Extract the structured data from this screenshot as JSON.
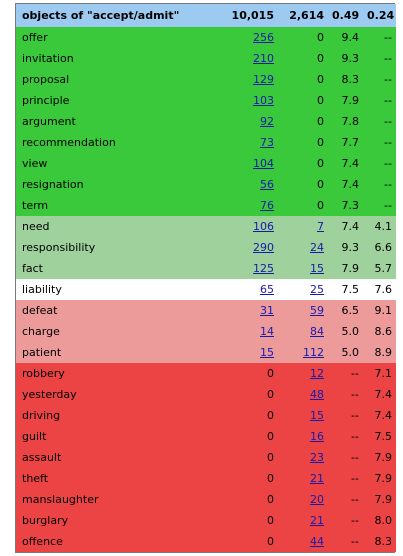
{
  "colors": {
    "header": "#9ccaf0",
    "bright_green": "#39c93a",
    "light_green": "#9ed19b",
    "white": "#ffffff",
    "pink": "#ec9a9a",
    "red": "#ec4444"
  },
  "header": {
    "label": "objects of \"accept/admit\"",
    "col1": "10,015",
    "col2": "2,614",
    "col3": "0.49",
    "col4": "0.24"
  },
  "rows": [
    {
      "word": "offer",
      "c1": "256",
      "c1_link": true,
      "c2": "0",
      "c2_link": false,
      "c3": "9.4",
      "c4": "--",
      "group": "bright_green"
    },
    {
      "word": "invitation",
      "c1": "210",
      "c1_link": true,
      "c2": "0",
      "c2_link": false,
      "c3": "9.3",
      "c4": "--",
      "group": "bright_green"
    },
    {
      "word": "proposal",
      "c1": "129",
      "c1_link": true,
      "c2": "0",
      "c2_link": false,
      "c3": "8.3",
      "c4": "--",
      "group": "bright_green"
    },
    {
      "word": "principle",
      "c1": "103",
      "c1_link": true,
      "c2": "0",
      "c2_link": false,
      "c3": "7.9",
      "c4": "--",
      "group": "bright_green"
    },
    {
      "word": "argument",
      "c1": "92",
      "c1_link": true,
      "c2": "0",
      "c2_link": false,
      "c3": "7.8",
      "c4": "--",
      "group": "bright_green"
    },
    {
      "word": "recommendation",
      "c1": "73",
      "c1_link": true,
      "c2": "0",
      "c2_link": false,
      "c3": "7.7",
      "c4": "--",
      "group": "bright_green"
    },
    {
      "word": "view",
      "c1": "104",
      "c1_link": true,
      "c2": "0",
      "c2_link": false,
      "c3": "7.4",
      "c4": "--",
      "group": "bright_green"
    },
    {
      "word": "resignation",
      "c1": "56",
      "c1_link": true,
      "c2": "0",
      "c2_link": false,
      "c3": "7.4",
      "c4": "--",
      "group": "bright_green"
    },
    {
      "word": "term",
      "c1": "76",
      "c1_link": true,
      "c2": "0",
      "c2_link": false,
      "c3": "7.3",
      "c4": "--",
      "group": "bright_green"
    },
    {
      "word": "need",
      "c1": "106",
      "c1_link": true,
      "c2": "7",
      "c2_link": true,
      "c3": "7.4",
      "c4": "4.1",
      "group": "light_green"
    },
    {
      "word": "responsibility",
      "c1": "290",
      "c1_link": true,
      "c2": "24",
      "c2_link": true,
      "c3": "9.3",
      "c4": "6.6",
      "group": "light_green"
    },
    {
      "word": "fact",
      "c1": "125",
      "c1_link": true,
      "c2": "15",
      "c2_link": true,
      "c3": "7.9",
      "c4": "5.7",
      "group": "light_green"
    },
    {
      "word": "liability",
      "c1": "65",
      "c1_link": true,
      "c2": "25",
      "c2_link": true,
      "c3": "7.5",
      "c4": "7.6",
      "group": "white"
    },
    {
      "word": "defeat",
      "c1": "31",
      "c1_link": true,
      "c2": "59",
      "c2_link": true,
      "c3": "6.5",
      "c4": "9.1",
      "group": "pink"
    },
    {
      "word": "charge",
      "c1": "14",
      "c1_link": true,
      "c2": "84",
      "c2_link": true,
      "c3": "5.0",
      "c4": "8.6",
      "group": "pink"
    },
    {
      "word": "patient",
      "c1": "15",
      "c1_link": true,
      "c2": "112",
      "c2_link": true,
      "c3": "5.0",
      "c4": "8.9",
      "group": "pink"
    },
    {
      "word": "robbery",
      "c1": "0",
      "c1_link": false,
      "c2": "12",
      "c2_link": true,
      "c3": "--",
      "c4": "7.1",
      "group": "red"
    },
    {
      "word": "yesterday",
      "c1": "0",
      "c1_link": false,
      "c2": "48",
      "c2_link": true,
      "c3": "--",
      "c4": "7.4",
      "group": "red"
    },
    {
      "word": "driving",
      "c1": "0",
      "c1_link": false,
      "c2": "15",
      "c2_link": true,
      "c3": "--",
      "c4": "7.4",
      "group": "red"
    },
    {
      "word": "guilt",
      "c1": "0",
      "c1_link": false,
      "c2": "16",
      "c2_link": true,
      "c3": "--",
      "c4": "7.5",
      "group": "red"
    },
    {
      "word": "assault",
      "c1": "0",
      "c1_link": false,
      "c2": "23",
      "c2_link": true,
      "c3": "--",
      "c4": "7.9",
      "group": "red"
    },
    {
      "word": "theft",
      "c1": "0",
      "c1_link": false,
      "c2": "21",
      "c2_link": true,
      "c3": "--",
      "c4": "7.9",
      "group": "red"
    },
    {
      "word": "manslaughter",
      "c1": "0",
      "c1_link": false,
      "c2": "20",
      "c2_link": true,
      "c3": "--",
      "c4": "7.9",
      "group": "red"
    },
    {
      "word": "burglary",
      "c1": "0",
      "c1_link": false,
      "c2": "21",
      "c2_link": true,
      "c3": "--",
      "c4": "8.0",
      "group": "red"
    },
    {
      "word": "offence",
      "c1": "0",
      "c1_link": false,
      "c2": "44",
      "c2_link": true,
      "c3": "--",
      "c4": "8.3",
      "group": "red"
    }
  ]
}
